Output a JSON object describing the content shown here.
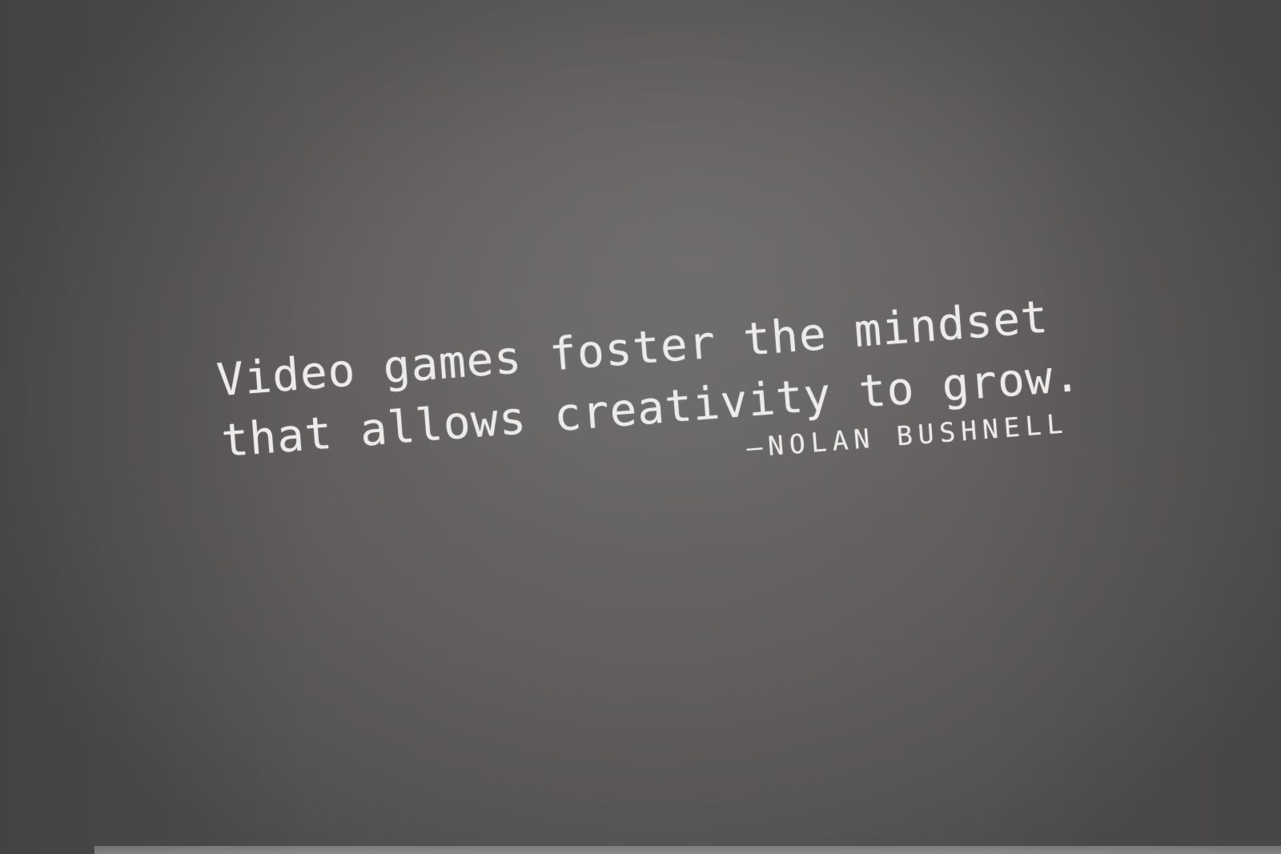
{
  "quote": {
    "line1": "Video games foster the mindset",
    "line2": "that allows creativity to grow.",
    "attribution": "—NOLAN BUSHNELL"
  },
  "colors": {
    "wall": "#625f5e",
    "text": "#ecebea",
    "floor_strip": "#858687"
  }
}
